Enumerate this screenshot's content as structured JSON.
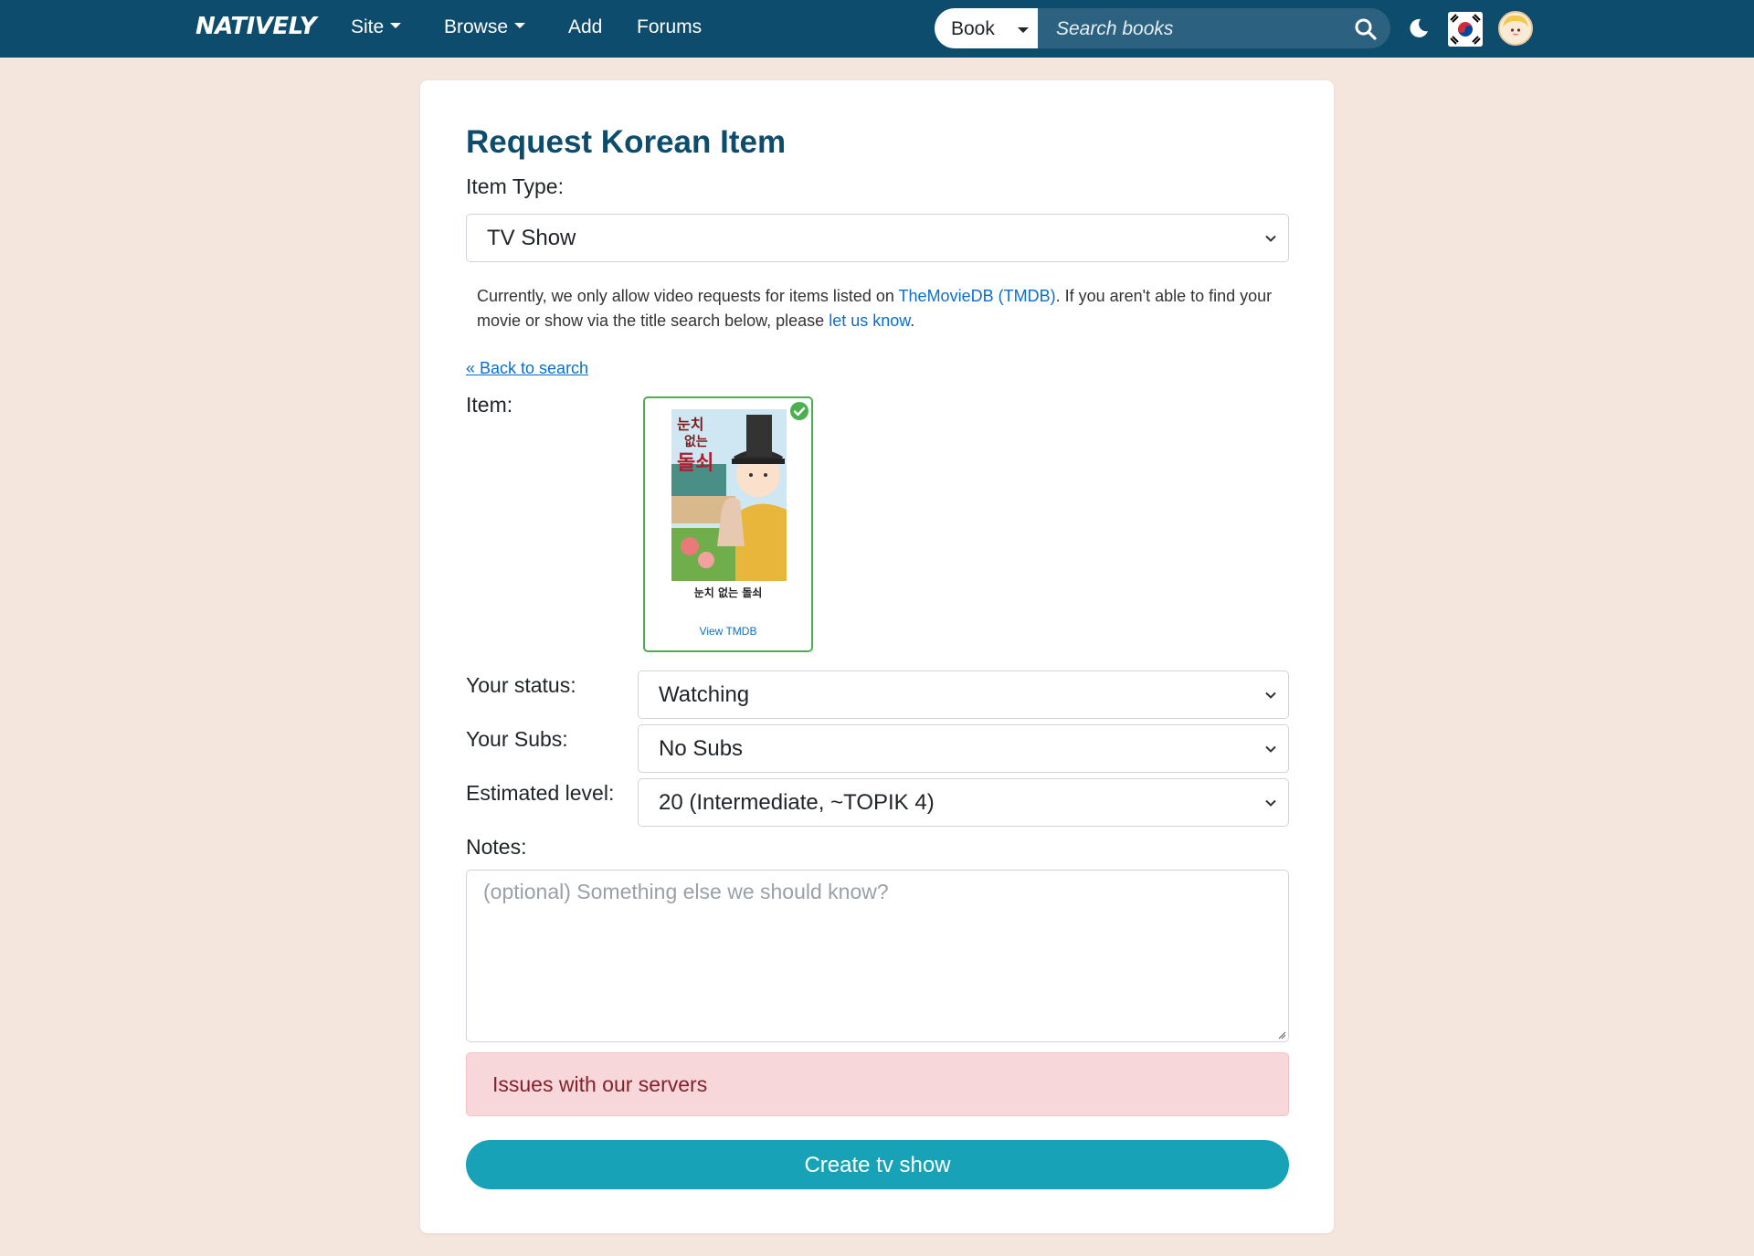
{
  "navbar": {
    "brand": "NATIVELY",
    "site_label": "Site",
    "browse_label": "Browse",
    "add_label": "Add",
    "forums_label": "Forums",
    "search_type": "Book",
    "search_placeholder": "Search books"
  },
  "form": {
    "title": "Request Korean Item",
    "item_type_label": "Item Type:",
    "item_type_value": "TV Show",
    "notice_before": "Currently, we only allow video requests for items listed on ",
    "notice_link": "TheMovieDB (TMDB)",
    "notice_middle": ". If you aren't able to find your movie or show via the title search below, please ",
    "notice_link2": "let us know",
    "notice_after": ".",
    "back_link": "« Back to search",
    "item_label": "Item:",
    "item_title": "눈치 없는 돌쇠",
    "item_link": "View TMDB",
    "status_label": "Your status:",
    "status_value": "Watching",
    "subs_label": "Your Subs:",
    "subs_value": "No Subs",
    "level_label": "Estimated level:",
    "level_value": "20 (Intermediate, ~TOPIK 4)",
    "notes_label": "Notes:",
    "notes_placeholder": "(optional) Something else we should know?",
    "alert_text": "Issues with our servers",
    "submit_label": "Create tv show"
  },
  "colors": {
    "navbar": "#0d4c6c",
    "page_bg": "#f4e5dd",
    "accent": "#17a2b8",
    "link": "#0a6ed1",
    "alert_bg": "#f8d7da",
    "selected_border": "#4caf50"
  },
  "icons": [
    "search-icon",
    "moon-icon",
    "korea-flag-icon",
    "avatar",
    "check-circle-icon",
    "chevron-down-icon",
    "resize-handle-icon"
  ]
}
